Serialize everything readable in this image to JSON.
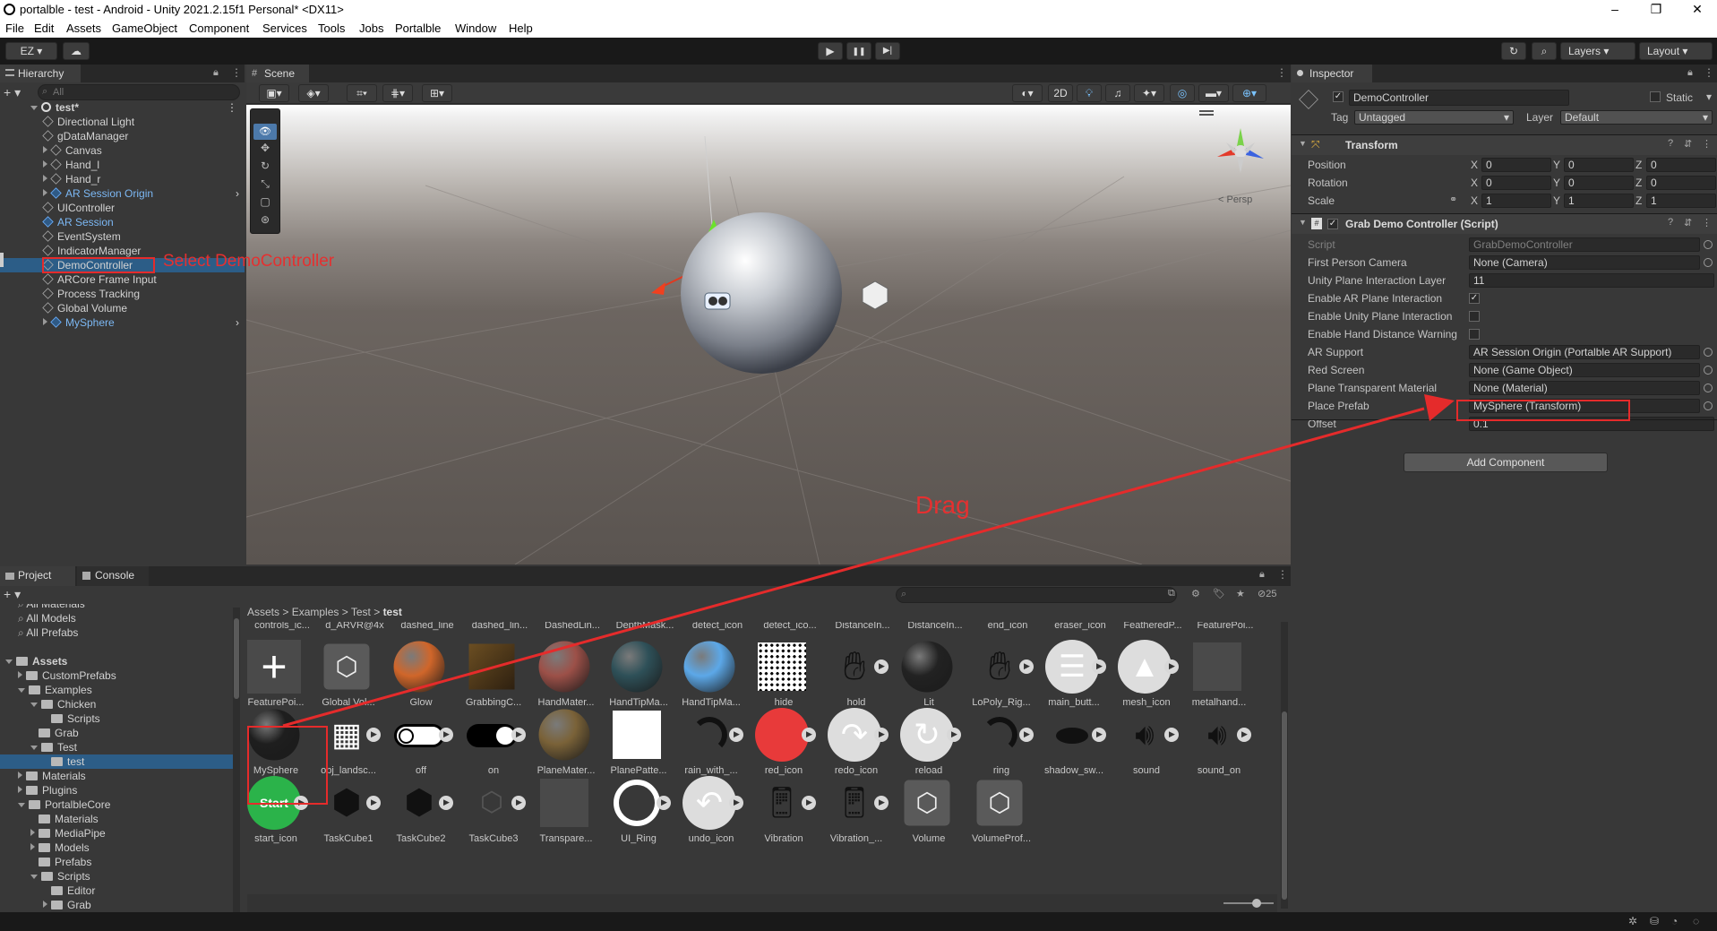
{
  "window": {
    "title": "portalble - test - Android - Unity 2021.2.15f1 Personal* <DX11>",
    "min": "–",
    "max": "❐",
    "close": "✕"
  },
  "menu": [
    "File",
    "Edit",
    "Assets",
    "GameObject",
    "Component",
    "Services",
    "Tools",
    "Jobs",
    "Portalble",
    "Window",
    "Help"
  ],
  "toolbar": {
    "account": "EZ ▾",
    "cloud": "☁",
    "play": "▶",
    "pause": "❚❚",
    "step": "▶|",
    "history": "↻",
    "search": "⌕",
    "layers": "Layers",
    "layout": "Layout"
  },
  "hierarchy": {
    "tab": "Hierarchy",
    "search_placeholder": "All",
    "add": "+ ▾",
    "scene": "test*",
    "items": [
      {
        "label": "Directional Light",
        "indent": 1,
        "arrow": false,
        "blue": false
      },
      {
        "label": "gDataManager",
        "indent": 1,
        "arrow": false,
        "blue": false
      },
      {
        "label": "Canvas",
        "indent": 1,
        "arrow": true,
        "blue": false
      },
      {
        "label": "Hand_l",
        "indent": 1,
        "arrow": true,
        "blue": false
      },
      {
        "label": "Hand_r",
        "indent": 1,
        "arrow": true,
        "blue": false
      },
      {
        "label": "AR Session Origin",
        "indent": 1,
        "arrow": true,
        "blue": true
      },
      {
        "label": "UIController",
        "indent": 1,
        "arrow": false,
        "blue": false
      },
      {
        "label": "AR Session",
        "indent": 1,
        "arrow": false,
        "blue": true
      },
      {
        "label": "EventSystem",
        "indent": 1,
        "arrow": false,
        "blue": false
      },
      {
        "label": "IndicatorManager",
        "indent": 1,
        "arrow": false,
        "blue": false
      },
      {
        "label": "DemoController",
        "indent": 1,
        "arrow": false,
        "blue": false,
        "selected": true
      },
      {
        "label": "ARCore Frame Input",
        "indent": 1,
        "arrow": false,
        "blue": false
      },
      {
        "label": "Process Tracking",
        "indent": 1,
        "arrow": false,
        "blue": false
      },
      {
        "label": "Global Volume",
        "indent": 1,
        "arrow": false,
        "blue": false
      },
      {
        "label": "MySphere",
        "indent": 1,
        "arrow": true,
        "blue": true
      }
    ]
  },
  "annotations": {
    "select": "Select DemoController",
    "drag": "Drag"
  },
  "scene": {
    "tab": "Scene",
    "persp": "< Persp",
    "mode2d": "2D"
  },
  "inspector": {
    "tab": "Inspector",
    "object_name": "DemoController",
    "static_label": "Static",
    "tag_label": "Tag",
    "tag_value": "Untagged",
    "layer_label": "Layer",
    "layer_value": "Default",
    "transform": {
      "title": "Transform",
      "rows": [
        {
          "label": "Position",
          "x": "0",
          "y": "0",
          "z": "0"
        },
        {
          "label": "Rotation",
          "x": "0",
          "y": "0",
          "z": "0"
        },
        {
          "label": "Scale",
          "x": "1",
          "y": "1",
          "z": "1"
        }
      ]
    },
    "axes": {
      "x": "X",
      "y": "Y",
      "z": "Z"
    },
    "script_component": {
      "title": "Grab Demo Controller (Script)",
      "rows": [
        {
          "label": "Script",
          "value": "GrabDemoController",
          "type": "ref"
        },
        {
          "label": "First Person Camera",
          "value": "None (Camera)",
          "type": "ref"
        },
        {
          "label": "Unity Plane Interaction Layer",
          "value": "11",
          "type": "text"
        },
        {
          "label": "Enable AR Plane Interaction",
          "value": "✓",
          "type": "check"
        },
        {
          "label": "Enable Unity Plane Interaction",
          "value": "",
          "type": "check"
        },
        {
          "label": "Enable Hand Distance Warning",
          "value": "",
          "type": "check"
        },
        {
          "label": "AR Support",
          "value": "AR Session Origin (Portalble AR Support)",
          "type": "ref"
        },
        {
          "label": "Red Screen",
          "value": "None (Game Object)",
          "type": "ref"
        },
        {
          "label": "Plane Transparent Material",
          "value": "None (Material)",
          "type": "ref"
        },
        {
          "label": "Place Prefab",
          "value": "MySphere (Transform)",
          "type": "ref",
          "highlight": true
        },
        {
          "label": "Offset",
          "value": "0.1",
          "type": "text"
        }
      ]
    },
    "add_component": "Add Component"
  },
  "project": {
    "tab_project": "Project",
    "tab_console": "Console",
    "add": "+ ▾",
    "hidden_count": "25",
    "breadcrumb": [
      "Assets",
      "Examples",
      "Test",
      "test"
    ],
    "tree": [
      {
        "label": "All Materials",
        "indent": 1,
        "kind": "search"
      },
      {
        "label": "All Models",
        "indent": 1,
        "kind": "search"
      },
      {
        "label": "All Prefabs",
        "indent": 1,
        "kind": "search"
      },
      {
        "label": "",
        "indent": 0,
        "kind": "blank"
      },
      {
        "label": "Assets",
        "indent": 0,
        "kind": "folder-open",
        "bold": true
      },
      {
        "label": "CustomPrefabs",
        "indent": 1,
        "kind": "folder"
      },
      {
        "label": "Examples",
        "indent": 1,
        "kind": "folder-open"
      },
      {
        "label": "Chicken",
        "indent": 2,
        "kind": "folder-open"
      },
      {
        "label": "Scripts",
        "indent": 3,
        "kind": "folder-leaf"
      },
      {
        "label": "Grab",
        "indent": 2,
        "kind": "folder-leaf"
      },
      {
        "label": "Test",
        "indent": 2,
        "kind": "folder-open"
      },
      {
        "label": "test",
        "indent": 3,
        "kind": "folder-leaf",
        "selected": true
      },
      {
        "label": "Materials",
        "indent": 1,
        "kind": "folder"
      },
      {
        "label": "Plugins",
        "indent": 1,
        "kind": "folder"
      },
      {
        "label": "PortalbleCore",
        "indent": 1,
        "kind": "folder-open"
      },
      {
        "label": "Materials",
        "indent": 2,
        "kind": "folder-leaf"
      },
      {
        "label": "MediaPipe",
        "indent": 2,
        "kind": "folder"
      },
      {
        "label": "Models",
        "indent": 2,
        "kind": "folder"
      },
      {
        "label": "Prefabs",
        "indent": 2,
        "kind": "folder-leaf"
      },
      {
        "label": "Scripts",
        "indent": 2,
        "kind": "folder-open"
      },
      {
        "label": "Editor",
        "indent": 3,
        "kind": "folder-leaf"
      },
      {
        "label": "Grab",
        "indent": 3,
        "kind": "folder"
      }
    ],
    "top_labels": [
      "controls_ic...",
      "d_ARVR@4x",
      "dashed_line",
      "dashed_lin...",
      "DashedLin...",
      "DepthMask...",
      "detect_icon",
      "detect_ico...",
      "DistanceIn...",
      "DistanceIn...",
      "end_icon",
      "eraser_icon",
      "FeatheredP...",
      "FeaturePoi..."
    ],
    "assets_row1": [
      {
        "label": "FeaturePoi...",
        "kind": "plus"
      },
      {
        "label": "Global Vol...",
        "kind": "cubeicon"
      },
      {
        "label": "Glow",
        "kind": "sphere",
        "color": "#d0662a"
      },
      {
        "label": "GrabbingC...",
        "kind": "box",
        "color": "#6b4e22"
      },
      {
        "label": "HandMater...",
        "kind": "sphere",
        "color": "#9c5048"
      },
      {
        "label": "HandTipMa...",
        "kind": "sphere",
        "color": "#2e5058"
      },
      {
        "label": "HandTipMa...",
        "kind": "sphere",
        "color": "#5ca8e8"
      },
      {
        "label": "hide",
        "kind": "dots"
      },
      {
        "label": "hold",
        "kind": "hand",
        "play": true
      },
      {
        "label": "Lit",
        "kind": "sphere",
        "color": "#222222"
      },
      {
        "label": "LoPoly_Rig...",
        "kind": "hand2",
        "play": true
      },
      {
        "label": "main_butt...",
        "kind": "menu",
        "play": true
      },
      {
        "label": "mesh_icon",
        "kind": "mesh",
        "play": true
      },
      {
        "label": "metalhand...",
        "kind": "flat",
        "color": "#4a4a4a"
      }
    ],
    "assets_row2": [
      {
        "label": "MySphere",
        "kind": "sphere",
        "color": "#1e1e1e",
        "highlight": true
      },
      {
        "label": "obj_landsc...",
        "kind": "landscape",
        "play": true
      },
      {
        "label": "off",
        "kind": "toggle-off",
        "play": true
      },
      {
        "label": "on",
        "kind": "toggle-on",
        "play": true
      },
      {
        "label": "PlaneMater...",
        "kind": "sphere",
        "color": "#7a6238"
      },
      {
        "label": "PlanePatte...",
        "kind": "flat",
        "color": "#ffffff"
      },
      {
        "label": "rain_with_...",
        "kind": "ring-partial",
        "play": true
      },
      {
        "label": "red_icon",
        "kind": "redcircle",
        "play": true
      },
      {
        "label": "redo_icon",
        "kind": "redo",
        "play": true
      },
      {
        "label": "reload",
        "kind": "reload",
        "play": true
      },
      {
        "label": "ring",
        "kind": "ring-partial",
        "play": true
      },
      {
        "label": "shadow_sw...",
        "kind": "shadow",
        "play": true
      },
      {
        "label": "sound",
        "kind": "sound",
        "play": true
      },
      {
        "label": "sound_on",
        "kind": "sound",
        "play": true
      }
    ],
    "assets_row3": [
      {
        "label": "start_icon",
        "kind": "start",
        "text": "Start",
        "play": true
      },
      {
        "label": "TaskCube1",
        "kind": "cube-dark",
        "play": true
      },
      {
        "label": "TaskCube2",
        "kind": "cube-dark",
        "play": true
      },
      {
        "label": "TaskCube3",
        "kind": "cube-outline",
        "play": true
      },
      {
        "label": "Transpare...",
        "kind": "flat",
        "color": "#4a4a4a"
      },
      {
        "label": "UI_Ring",
        "kind": "ring",
        "play": true
      },
      {
        "label": "undo_icon",
        "kind": "undo",
        "play": true
      },
      {
        "label": "Vibration",
        "kind": "phone",
        "play": true
      },
      {
        "label": "Vibration_...",
        "kind": "phone",
        "play": true
      },
      {
        "label": "Volume",
        "kind": "cubeicon"
      },
      {
        "label": "VolumeProf...",
        "kind": "cubeicon"
      }
    ]
  }
}
